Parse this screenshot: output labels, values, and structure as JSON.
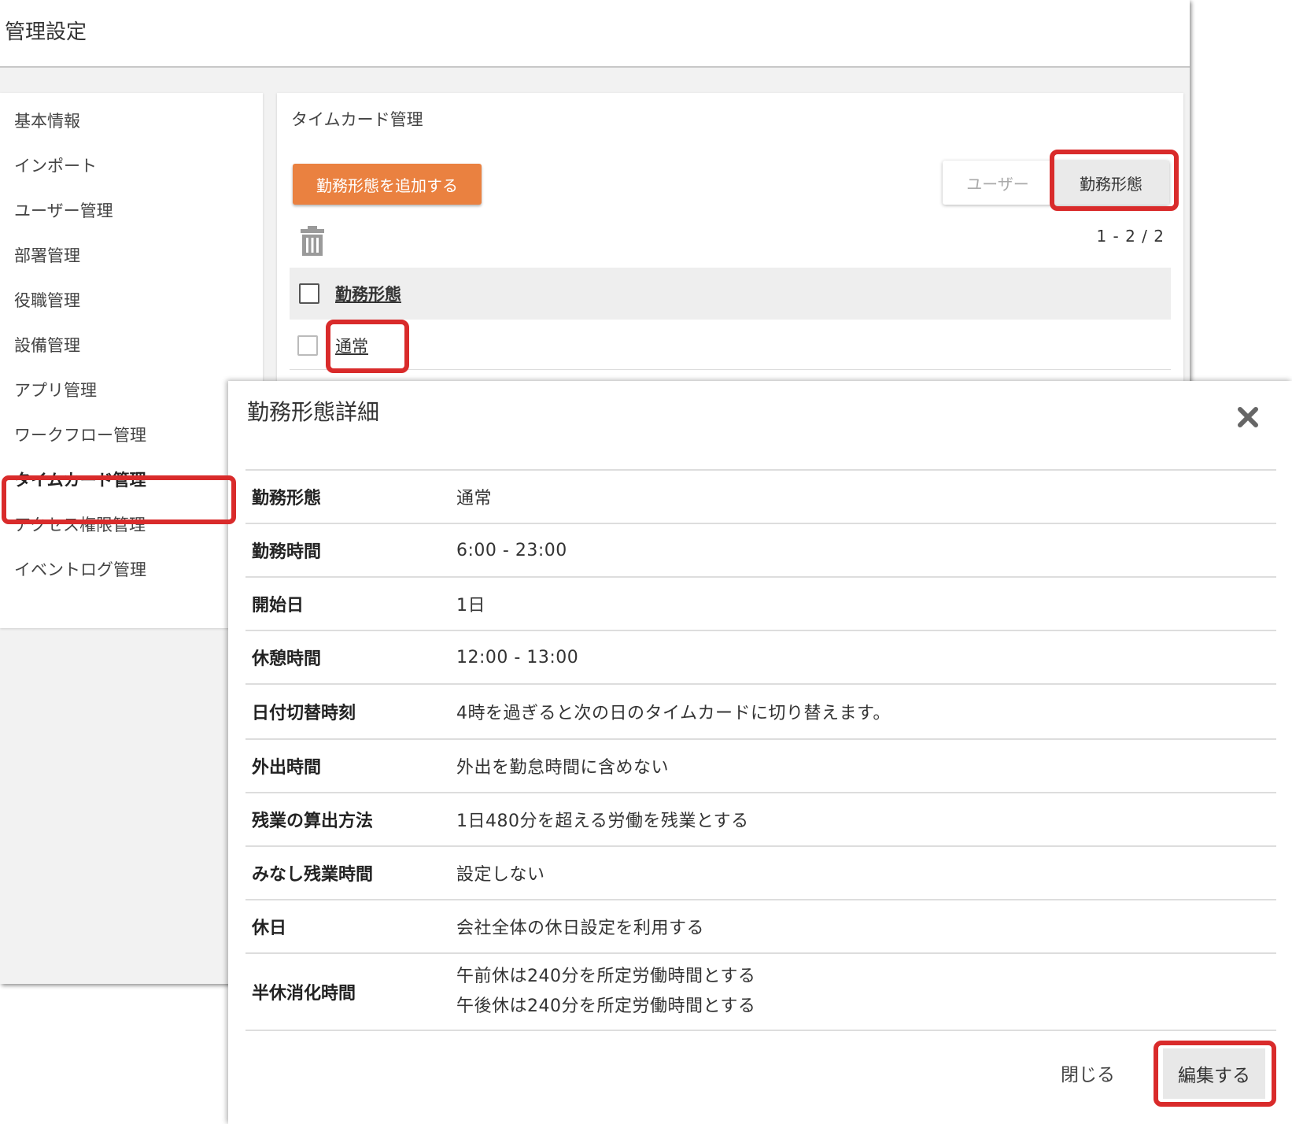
{
  "header": {
    "title": "管理設定"
  },
  "sidebar": {
    "items": [
      {
        "label": "基本情報",
        "active": false
      },
      {
        "label": "インポート",
        "active": false
      },
      {
        "label": "ユーザー管理",
        "active": false
      },
      {
        "label": "部署管理",
        "active": false
      },
      {
        "label": "役職管理",
        "active": false
      },
      {
        "label": "設備管理",
        "active": false
      },
      {
        "label": "アプリ管理",
        "active": false
      },
      {
        "label": "ワークフロー管理",
        "active": false
      },
      {
        "label": "タイムカード管理",
        "active": true
      },
      {
        "label": "アクセス権限管理",
        "active": false
      },
      {
        "label": "イベントログ管理",
        "active": false
      }
    ]
  },
  "main": {
    "title": "タイムカード管理",
    "add_button_label": "勤務形態を追加する",
    "toggle": {
      "user_label": "ユーザー",
      "worktype_label": "勤務形態",
      "selected": "勤務形態"
    },
    "pagination": "1 - 2 / 2",
    "table": {
      "header_label": "勤務形態",
      "rows": [
        {
          "label": "通常"
        }
      ]
    }
  },
  "modal": {
    "title": "勤務形態詳細",
    "rows": [
      {
        "label": "勤務形態",
        "value": "通常"
      },
      {
        "label": "勤務時間",
        "value": "6:00 - 23:00"
      },
      {
        "label": "開始日",
        "value": "1日"
      },
      {
        "label": "休憩時間",
        "value": "12:00 - 13:00"
      },
      {
        "label": "日付切替時刻",
        "value": "4時を過ぎると次の日のタイムカードに切り替えます。"
      },
      {
        "label": "外出時間",
        "value": "外出を勤怠時間に含めない"
      },
      {
        "label": "残業の算出方法",
        "value": "1日480分を超える労働を残業とする"
      },
      {
        "label": "みなし残業時間",
        "value": "設定しない"
      },
      {
        "label": "休日",
        "value": "会社全体の休日設定を利用する"
      },
      {
        "label": "半休消化時間",
        "value_lines": [
          "午前休は240分を所定労働時間とする",
          "午後休は240分を所定労働時間とする"
        ]
      }
    ],
    "close_label": "閉じる",
    "edit_label": "編集する"
  },
  "colors": {
    "accent_orange": "#ea8140",
    "highlight_red": "#d92b2b"
  }
}
